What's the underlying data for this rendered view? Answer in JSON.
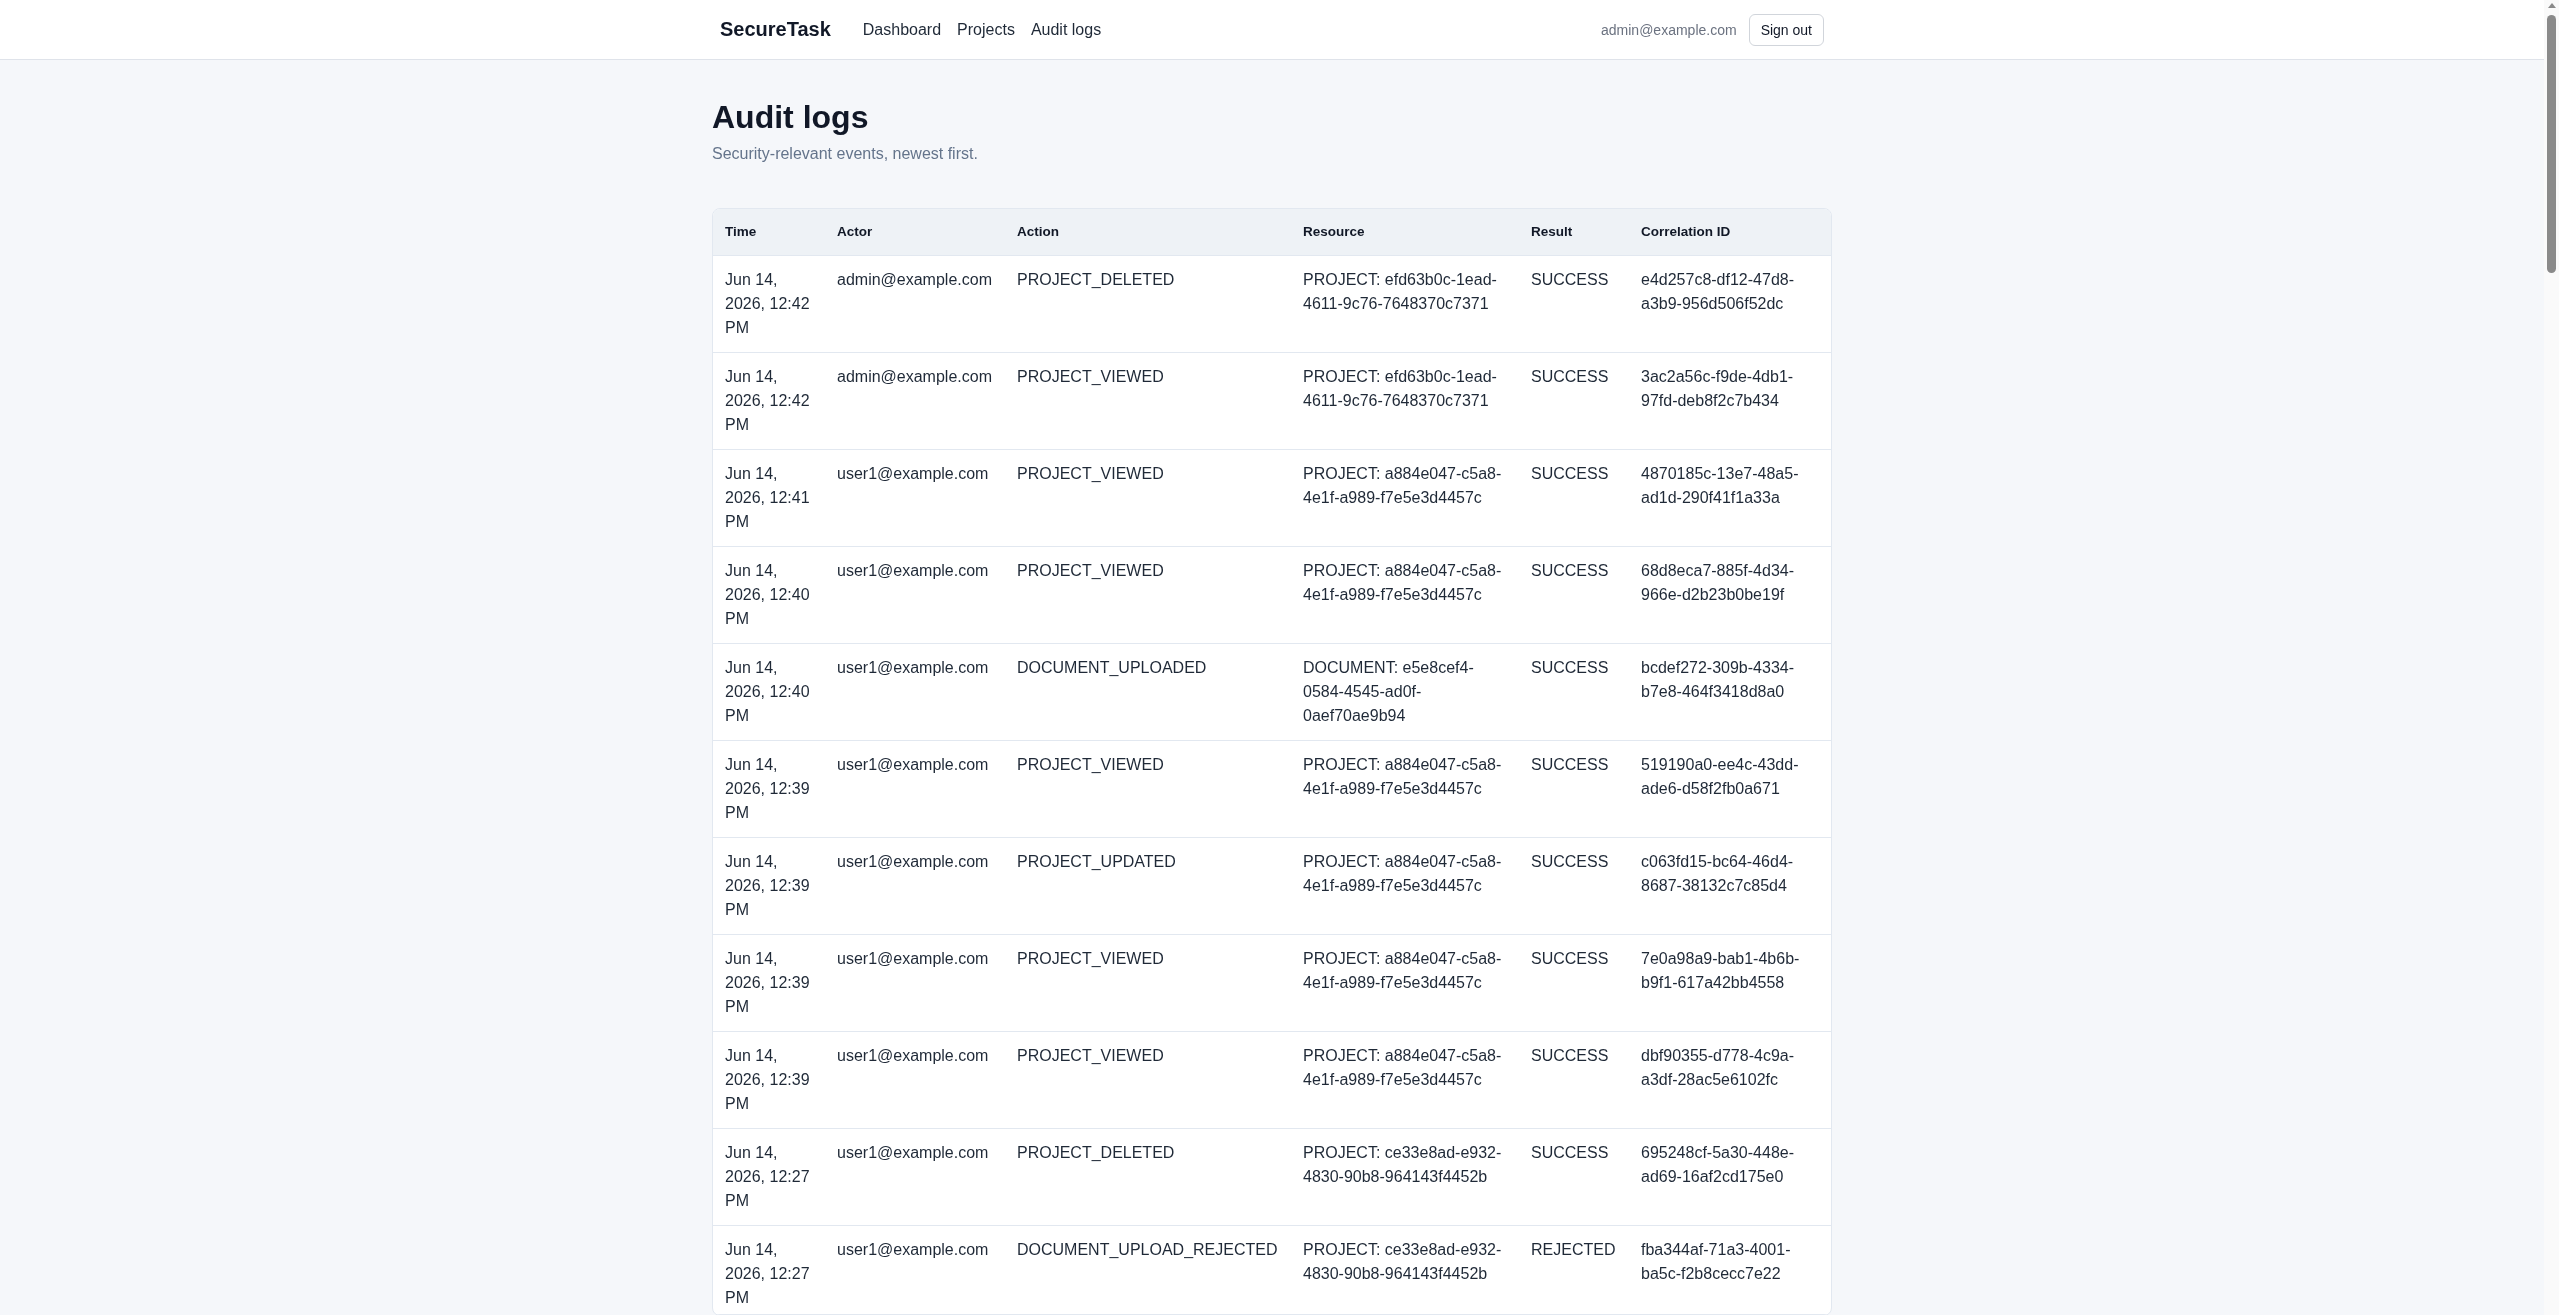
{
  "navbar": {
    "brand": "SecureTask",
    "links": [
      "Dashboard",
      "Projects",
      "Audit logs"
    ],
    "user_email": "admin@example.com",
    "sign_out": "Sign out"
  },
  "page": {
    "title": "Audit logs",
    "subtitle": "Security-relevant events, newest first."
  },
  "table": {
    "columns": [
      "Time",
      "Actor",
      "Action",
      "Resource",
      "Result",
      "Correlation ID"
    ],
    "rows": [
      {
        "time": "Jun 14, 2026, 12:42 PM",
        "actor": "admin@example.com",
        "action": "PROJECT_DELETED",
        "resource": "PROJECT: efd63b0c-1ead-4611-9c76-7648370c7371",
        "result": "SUCCESS",
        "correlation_id": "e4d257c8-df12-47d8-a3b9-956d506f52dc"
      },
      {
        "time": "Jun 14, 2026, 12:42 PM",
        "actor": "admin@example.com",
        "action": "PROJECT_VIEWED",
        "resource": "PROJECT: efd63b0c-1ead-4611-9c76-7648370c7371",
        "result": "SUCCESS",
        "correlation_id": "3ac2a56c-f9de-4db1-97fd-deb8f2c7b434"
      },
      {
        "time": "Jun 14, 2026, 12:41 PM",
        "actor": "user1@example.com",
        "action": "PROJECT_VIEWED",
        "resource": "PROJECT: a884e047-c5a8-4e1f-a989-f7e5e3d4457c",
        "result": "SUCCESS",
        "correlation_id": "4870185c-13e7-48a5-ad1d-290f41f1a33a"
      },
      {
        "time": "Jun 14, 2026, 12:40 PM",
        "actor": "user1@example.com",
        "action": "PROJECT_VIEWED",
        "resource": "PROJECT: a884e047-c5a8-4e1f-a989-f7e5e3d4457c",
        "result": "SUCCESS",
        "correlation_id": "68d8eca7-885f-4d34-966e-d2b23b0be19f"
      },
      {
        "time": "Jun 14, 2026, 12:40 PM",
        "actor": "user1@example.com",
        "action": "DOCUMENT_UPLOADED",
        "resource": "DOCUMENT: e5e8cef4-0584-4545-ad0f-0aef70ae9b94",
        "result": "SUCCESS",
        "correlation_id": "bcdef272-309b-4334-b7e8-464f3418d8a0"
      },
      {
        "time": "Jun 14, 2026, 12:39 PM",
        "actor": "user1@example.com",
        "action": "PROJECT_VIEWED",
        "resource": "PROJECT: a884e047-c5a8-4e1f-a989-f7e5e3d4457c",
        "result": "SUCCESS",
        "correlation_id": "519190a0-ee4c-43dd-ade6-d58f2fb0a671"
      },
      {
        "time": "Jun 14, 2026, 12:39 PM",
        "actor": "user1@example.com",
        "action": "PROJECT_UPDATED",
        "resource": "PROJECT: a884e047-c5a8-4e1f-a989-f7e5e3d4457c",
        "result": "SUCCESS",
        "correlation_id": "c063fd15-bc64-46d4-8687-38132c7c85d4"
      },
      {
        "time": "Jun 14, 2026, 12:39 PM",
        "actor": "user1@example.com",
        "action": "PROJECT_VIEWED",
        "resource": "PROJECT: a884e047-c5a8-4e1f-a989-f7e5e3d4457c",
        "result": "SUCCESS",
        "correlation_id": "7e0a98a9-bab1-4b6b-b9f1-617a42bb4558"
      },
      {
        "time": "Jun 14, 2026, 12:39 PM",
        "actor": "user1@example.com",
        "action": "PROJECT_VIEWED",
        "resource": "PROJECT: a884e047-c5a8-4e1f-a989-f7e5e3d4457c",
        "result": "SUCCESS",
        "correlation_id": "dbf90355-d778-4c9a-a3df-28ac5e6102fc"
      },
      {
        "time": "Jun 14, 2026, 12:27 PM",
        "actor": "user1@example.com",
        "action": "PROJECT_DELETED",
        "resource": "PROJECT: ce33e8ad-e932-4830-90b8-964143f4452b",
        "result": "SUCCESS",
        "correlation_id": "695248cf-5a30-448e-ad69-16af2cd175e0"
      },
      {
        "time": "Jun 14, 2026, 12:27 PM",
        "actor": "user1@example.com",
        "action": "DOCUMENT_UPLOAD_REJECTED",
        "resource": "PROJECT: ce33e8ad-e932-4830-90b8-964143f4452b",
        "result": "REJECTED",
        "correlation_id": "fba344af-71a3-4001-ba5c-f2b8cecc7e22"
      }
    ]
  }
}
